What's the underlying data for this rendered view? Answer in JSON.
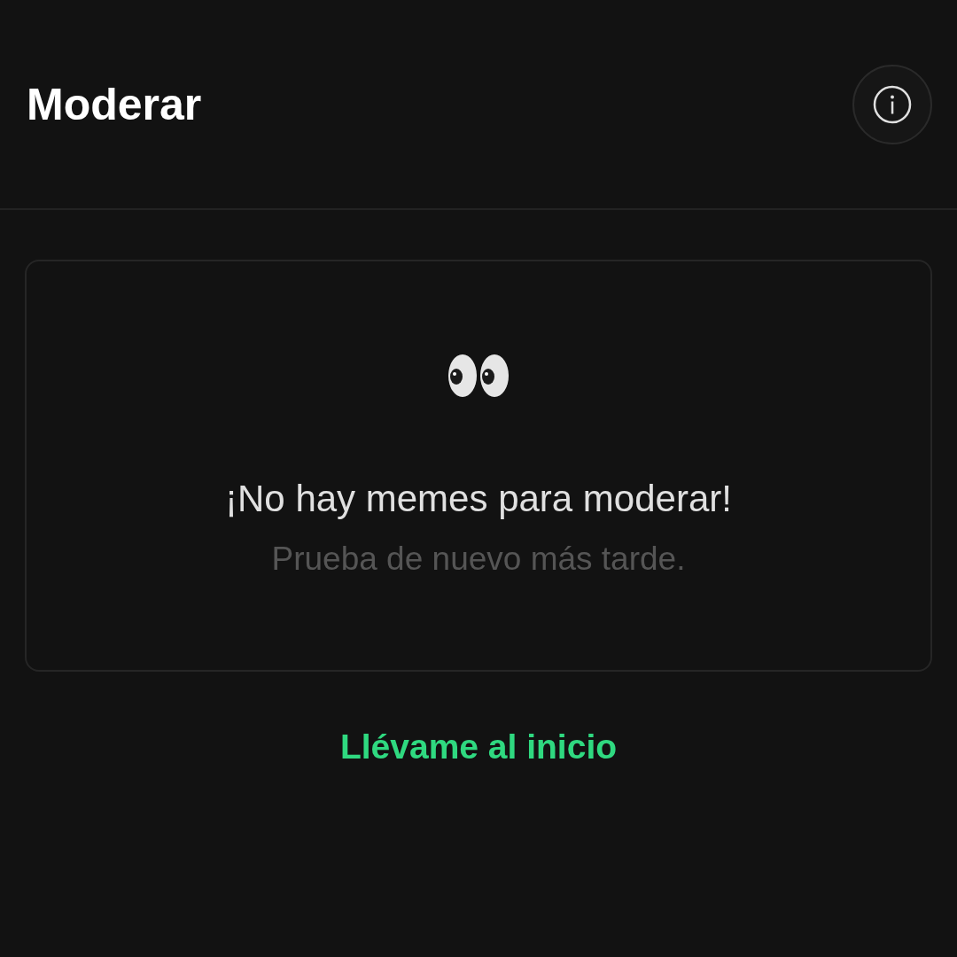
{
  "header": {
    "title": "Moderar"
  },
  "empty_state": {
    "message": "¡No hay memes para moderar!",
    "hint": "Prueba de nuevo más tarde."
  },
  "link": {
    "label": "Llévame al inicio"
  }
}
